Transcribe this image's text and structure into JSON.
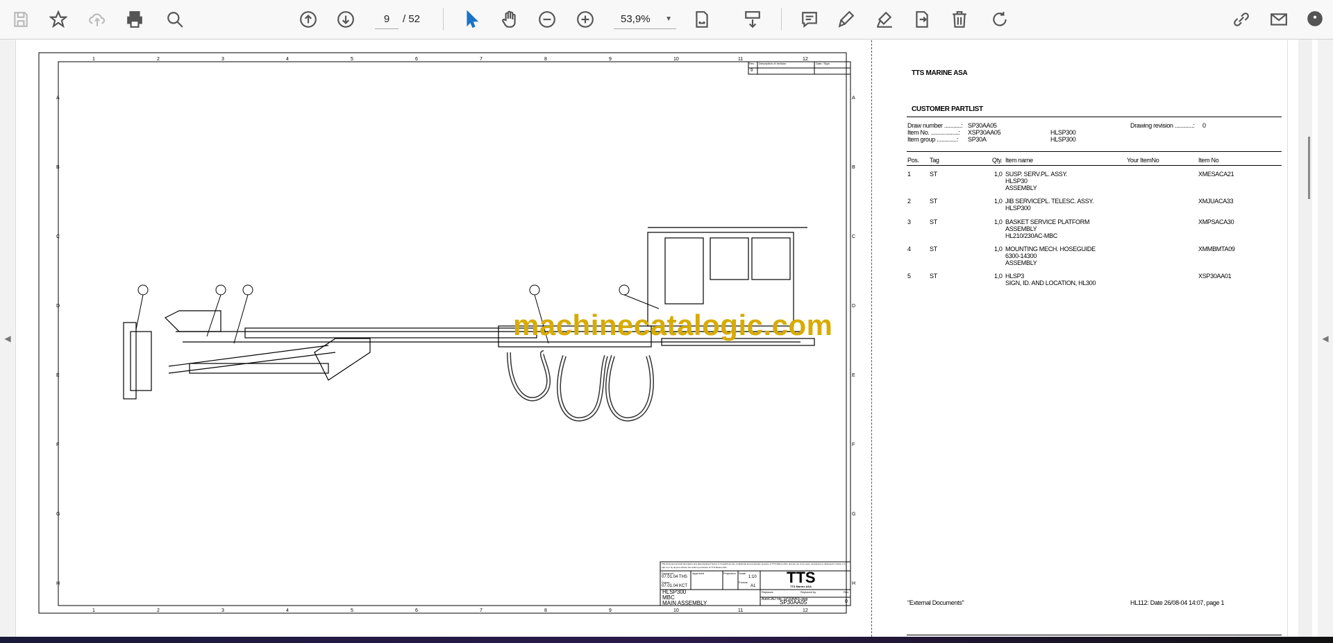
{
  "toolbar": {
    "page_current": "9",
    "page_total": "/ 52",
    "zoom": "53,9%",
    "icons": [
      "save-icon",
      "bookmark-star-icon",
      "cloud-upload-icon",
      "print-icon",
      "find-zoom-icon",
      "previous-page-icon",
      "next-page-icon",
      "select-cursor-icon",
      "hand-pan-icon",
      "zoom-out-icon",
      "zoom-in-icon",
      "fit-page-icon",
      "scrolling-mode-icon",
      "comment-icon",
      "highlight-icon",
      "sign-icon",
      "export-icon",
      "delete-icon",
      "rotate-icon",
      "share-link-icon",
      "email-icon",
      "account-icon"
    ]
  },
  "drawing": {
    "rev_header": [
      "Rev.",
      "Description of revision",
      "Date / Sign."
    ],
    "rev_value": "9",
    "columns": [
      "1",
      "2",
      "3",
      "4",
      "5",
      "6",
      "7",
      "8",
      "9",
      "10",
      "11",
      "12"
    ],
    "rows": [
      "A",
      "B",
      "C",
      "D",
      "E",
      "F",
      "G",
      "H"
    ],
    "title_block": {
      "notice": "This document and all information and data disclosed herein or herewith are the confidential and proprietary property of TTS Marine ASA, and are not to be used, reproduced or disclosed in whole or in part to or by anyone without the written permission of TTS Marine ASA.",
      "designed_label": "Designed",
      "designed": "07.01.04 THS",
      "drawn_label": "Drawn",
      "drawn": "07.01.04 KCT",
      "approved_label": "Approved",
      "projection_label": "Projection",
      "scale_label": "Scale",
      "scale": "1:10",
      "format_label": "Format",
      "format": "A1",
      "logo": "TTS",
      "company": "TTS Marine ASA",
      "title_lines": [
        "HLSP300",
        "MBC",
        "MAIN ASSEMBLY"
      ],
      "replaces_label": "Replaces",
      "replaced_by_label": "Replaced by",
      "autocad": "AutoCAD file: SP30AA05.dwg",
      "rev_label": "Rev.",
      "rev": "0",
      "drawing_no": "SP30AA05"
    }
  },
  "watermark": "machinecatalogic.com",
  "partlist": {
    "company": "TTS MARINE ASA",
    "title": "CUSTOMER PARTLIST",
    "draw_number_label": "Draw number ...........:",
    "draw_number": "SP30AA05",
    "item_no_label": "Item No. ..................:",
    "item_no": "XSP30AA05",
    "item_no_desc": "HLSP300",
    "item_group_label": "Item group .............:",
    "item_group": "SP30A",
    "item_group_desc": "HLSP300",
    "drawing_revision_label": "Drawing revision ............:",
    "drawing_revision": "0",
    "headers": [
      "Pos.",
      "Tag",
      "Qty.",
      "Item name",
      "Your ItemNo",
      "Item No"
    ],
    "rows": [
      {
        "pos": "1",
        "tag": "ST",
        "qty": "1,0",
        "name": [
          "SUSP. SERV.PL. ASSY.",
          "HLSP30",
          "ASSEMBLY"
        ],
        "item_no": "XMESACA21"
      },
      {
        "pos": "2",
        "tag": "ST",
        "qty": "1,0",
        "name": [
          "JIB SERVICEPL. TELESC. ASSY.",
          "HLSP300"
        ],
        "item_no": "XMJUACA33"
      },
      {
        "pos": "3",
        "tag": "ST",
        "qty": "1,0",
        "name": [
          "BASKET SERVICE PLATFORM",
          "ASSEMBLY",
          "HL210/230AC-MBC"
        ],
        "item_no": "XMPSACA30"
      },
      {
        "pos": "4",
        "tag": "ST",
        "qty": "1,0",
        "name": [
          "MOUNTING MECH. HOSEGUIDE",
          "6300-14300",
          "ASSEMBLY"
        ],
        "item_no": "XMMBMTA09"
      },
      {
        "pos": "5",
        "tag": "ST",
        "qty": "1,0",
        "name": [
          "HLSP3",
          "SIGN, ID.  AND LOCATION, HL300"
        ],
        "item_no": "XSP30AA01"
      }
    ],
    "footer_left": "\"External Documents\"",
    "footer_right": "HL112: Date 26/08-04 14:07, page 1"
  }
}
